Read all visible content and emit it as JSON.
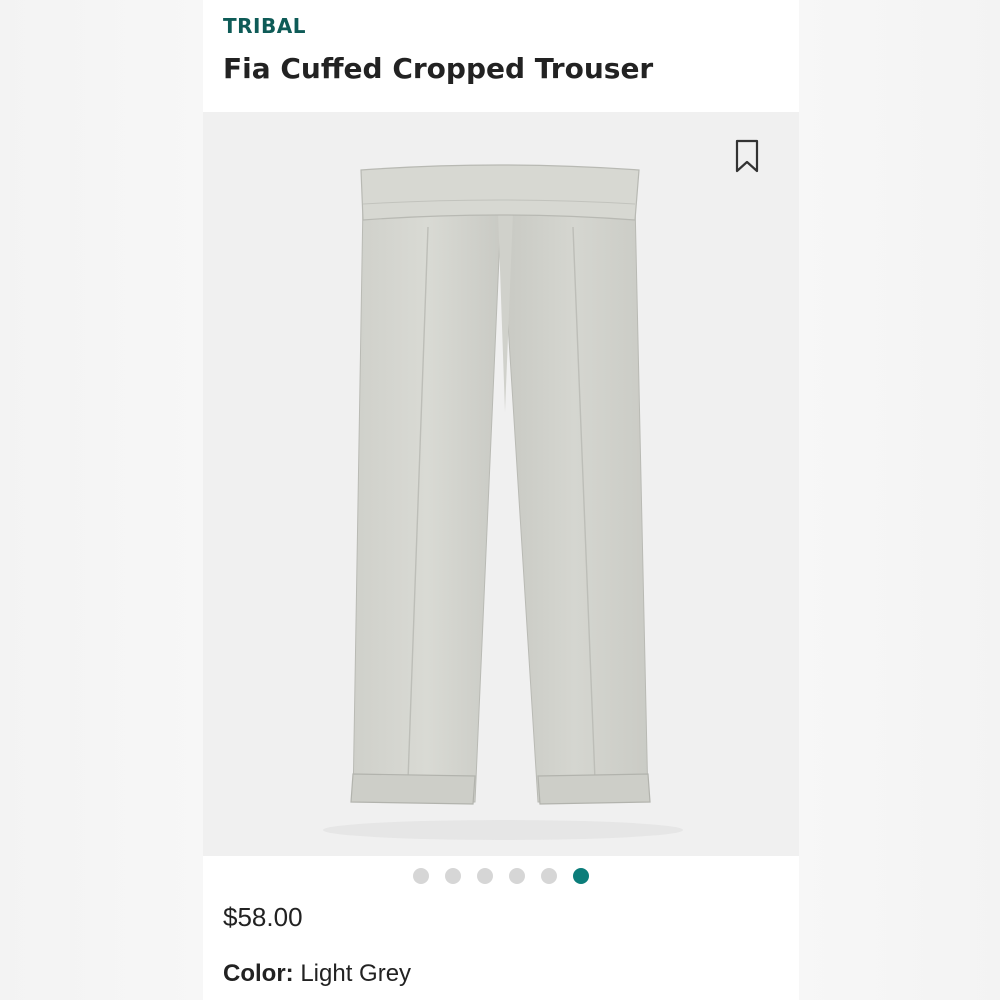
{
  "product": {
    "brand": "TRIBAL",
    "name": "Fia Cuffed Cropped Trouser",
    "price": "$58.00",
    "color_label": "Color:",
    "color_value": "Light Grey"
  },
  "gallery": {
    "image_count": 6,
    "active_index": 6
  },
  "colors": {
    "brand_accent": "#0e5b57",
    "active_dot": "#0b7d7a",
    "inactive_dot": "#d6d6d6",
    "garment": "#d4d5cf"
  },
  "icons": {
    "bookmark": "bookmark-icon"
  }
}
